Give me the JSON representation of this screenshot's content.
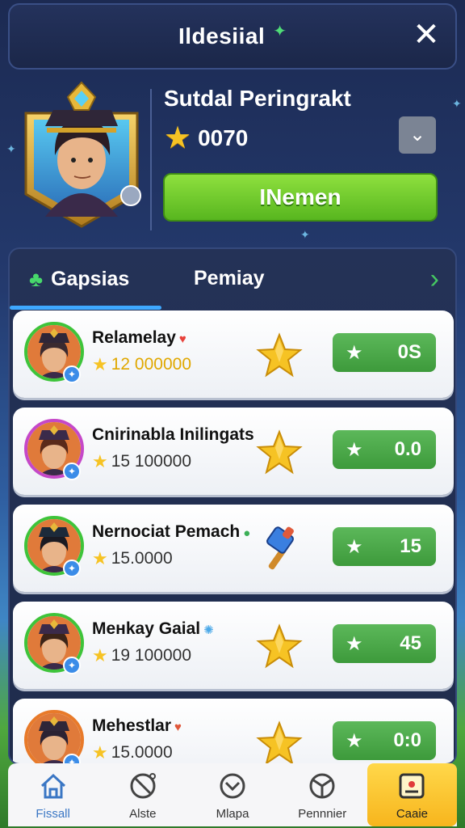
{
  "header": {
    "title": "Ildesiial",
    "gem_icon": "green-gem-icon",
    "close_icon": "✕"
  },
  "profile": {
    "name": "Sutdal Peringrakt",
    "score": "0070",
    "dropdown_icon": "chevron-down-icon",
    "primary_button": "INemen"
  },
  "tabs": [
    {
      "label": "Gapsias",
      "icon": "green-creature-icon",
      "active": true
    },
    {
      "label": "Pemiay",
      "active": false
    }
  ],
  "rows": [
    {
      "name": "Relamelay",
      "name_icon": "♥",
      "name_icon_color": "#e8413a",
      "sub": "12 000000",
      "sub_gold": true,
      "item": "star",
      "action": "0S",
      "ring": "#3ec43a"
    },
    {
      "name": "Cnirinabla Inilingats",
      "name_icon": "",
      "name_icon_color": "",
      "sub": "15 100000",
      "sub_gold": false,
      "item": "star",
      "action": "0.0",
      "ring": "#c548c8"
    },
    {
      "name": "Nernociat Pemach",
      "name_icon": "●",
      "name_icon_color": "#3caf57",
      "sub": "15.0000",
      "sub_gold": false,
      "item": "hammer",
      "action": "15",
      "ring": "#3ec43a"
    },
    {
      "name": "Meнkay Gaial",
      "name_icon": "✺",
      "name_icon_color": "#4aa8e8",
      "sub": "19 100000",
      "sub_gold": false,
      "item": "star",
      "action": "45",
      "ring": "#3ec43a"
    },
    {
      "name": "Mehestlar",
      "name_icon": "♥",
      "name_icon_color": "#e0573a",
      "sub": "15.0000",
      "sub_gold": false,
      "item": "star",
      "action": "0:0",
      "ring": "#e87a2a"
    }
  ],
  "bottom_nav": [
    {
      "label": "Fissall",
      "icon": "home-icon"
    },
    {
      "label": "Alste",
      "icon": "ban-icon"
    },
    {
      "label": "Mlapa",
      "icon": "map-icon"
    },
    {
      "label": "Pennnier",
      "icon": "shield-icon"
    },
    {
      "label": "Caaie",
      "icon": "shop-icon",
      "active": true
    }
  ],
  "colors": {
    "accent_green": "#58b61f",
    "tab_underline": "#3ea8ff",
    "star_gold": "#f6c324",
    "active_nav": "#f7b51d"
  }
}
